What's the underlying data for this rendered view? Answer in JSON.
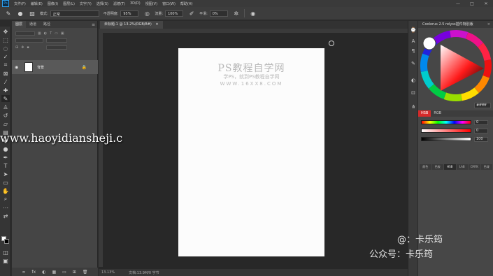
{
  "app": {
    "logo": "Ps"
  },
  "menubar": {
    "items": [
      "文件(F)",
      "编辑(E)",
      "图像(I)",
      "图层(L)",
      "文字(Y)",
      "选择(S)",
      "滤镜(T)",
      "3D(D)",
      "视图(V)",
      "窗口(W)",
      "帮助(H)"
    ],
    "window_controls": [
      "—",
      "□",
      "✕"
    ]
  },
  "options": {
    "mode_label": "模式:",
    "mode_value": "正常",
    "opacity_label": "不透明度:",
    "opacity_value": "95%",
    "flow_label": "流量:",
    "flow_value": "100%",
    "smooth_label": "平滑:",
    "smooth_value": "0%"
  },
  "layers_panel": {
    "tabs": [
      "图层",
      "通道",
      "路径"
    ],
    "menu_icon": "≡",
    "layer": {
      "eye": "◉",
      "name": "背景",
      "lock": "🔒"
    },
    "bottom_icons": [
      "∞",
      "fx",
      "◐",
      "▦",
      "▭",
      "⊞",
      "🗑"
    ]
  },
  "document": {
    "tab_title": "未标题-1 @ 13.2%(RGB/8#)",
    "tab_close": "×",
    "status_zoom": "13.13%",
    "status_doc": "文档:13.9M/0 字节"
  },
  "canvas_watermark": {
    "title": "PS教程自学网",
    "subtitle": "学PS，就到PS教程自学网",
    "url": "WWW.16XX8.COM"
  },
  "site_watermark": "www.haoyidiansheji.c",
  "coolorus": {
    "title": "Coolorus 2.5 relyss插件特别版",
    "close": "×",
    "hex": "#ffffff",
    "mode_tabs": [
      "HSB",
      "RGB"
    ],
    "slider_values": [
      "0",
      "0",
      "100"
    ],
    "bottom_tabs": [
      "颜色",
      "色板",
      "HSB",
      "LAB",
      "CMYK",
      "色域"
    ]
  },
  "social_watermark": {
    "line1": "@：卡乐筠",
    "line2": "公众号：卡乐筠"
  }
}
